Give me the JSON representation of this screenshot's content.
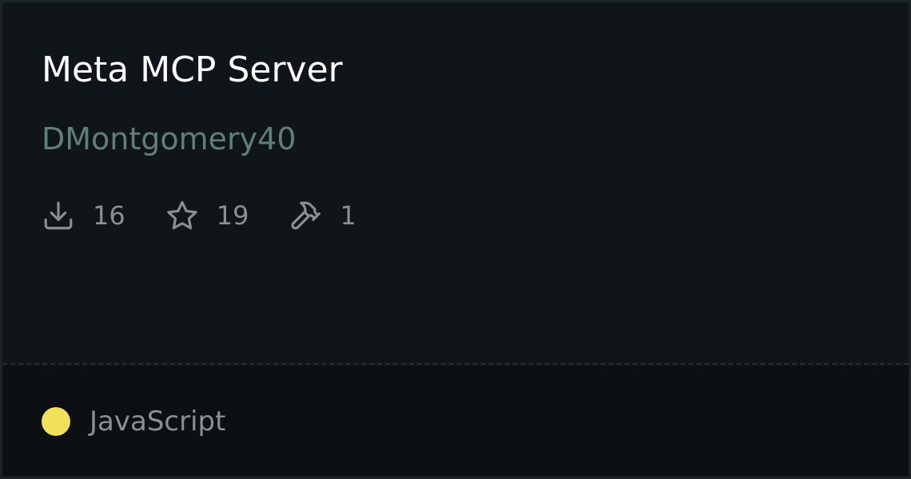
{
  "card": {
    "title": "Meta MCP Server",
    "author": "DMontgomery40",
    "stats": {
      "downloads": "16",
      "stars": "19",
      "tools": "1"
    },
    "language": {
      "name": "JavaScript",
      "color": "#f1e05a"
    }
  },
  "icons": {
    "downloads": "download-icon",
    "stars": "star-icon",
    "tools": "hammer-icon"
  }
}
